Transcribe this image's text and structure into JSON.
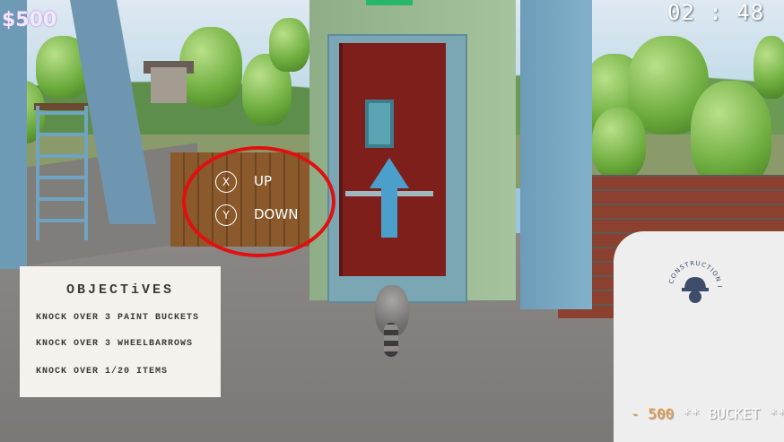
{
  "hud": {
    "money": "$500",
    "timer": "02 : 48"
  },
  "controls": {
    "up": {
      "button": "X",
      "label": "UP"
    },
    "down": {
      "button": "Y",
      "label": "DOWN"
    }
  },
  "objectives": {
    "title": "OBJECTiVES",
    "items": [
      "KNOCK OVER 3 PAINT BUCKETS",
      "KNOCK OVER 3 WHEELBARROWS",
      "KNOCK OVER 1/20 ITEMS"
    ]
  },
  "item_card": {
    "logo_text": "CONSTRUCTION INC.",
    "price": "- 500",
    "item": "** BUCKET **"
  },
  "colors": {
    "highlight_ring": "#e11010",
    "price_accent": "#f09a3e"
  }
}
